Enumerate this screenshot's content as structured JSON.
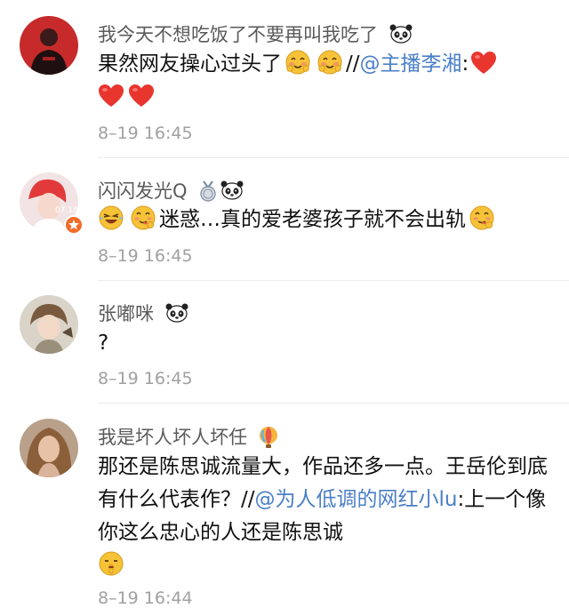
{
  "comments": [
    {
      "username": "我今天不想吃饭了不要再叫我吃了",
      "text_1": "果然网友操心过头了",
      "reply_prefix": "//",
      "mention": "@主播李湘",
      "colon": ":",
      "time": "8–19 16:45"
    },
    {
      "username": "闪闪发光Q",
      "text_1": "迷惑…真的爱老婆孩子就不会出轨",
      "time": "8–19 16:45"
    },
    {
      "username": "张嘟咪",
      "text_1": "?",
      "time": "8–19 16:45"
    },
    {
      "username": "我是坏人坏人坏任",
      "text_1": "那还是陈思诚流量大，作品还多一点。王岳伦到底有什么代表作？",
      "reply_prefix": "//",
      "mention": "@为人低调的网红小lu",
      "colon": ":",
      "text_2": "上一个像你这么忠心的人还是陈思诚",
      "time": "8–19 16:44"
    }
  ],
  "colors": {
    "link": "#4a7fc8",
    "timestamp": "#a0a0a0",
    "username": "#5a5a5a",
    "heart": "#e8352e"
  }
}
